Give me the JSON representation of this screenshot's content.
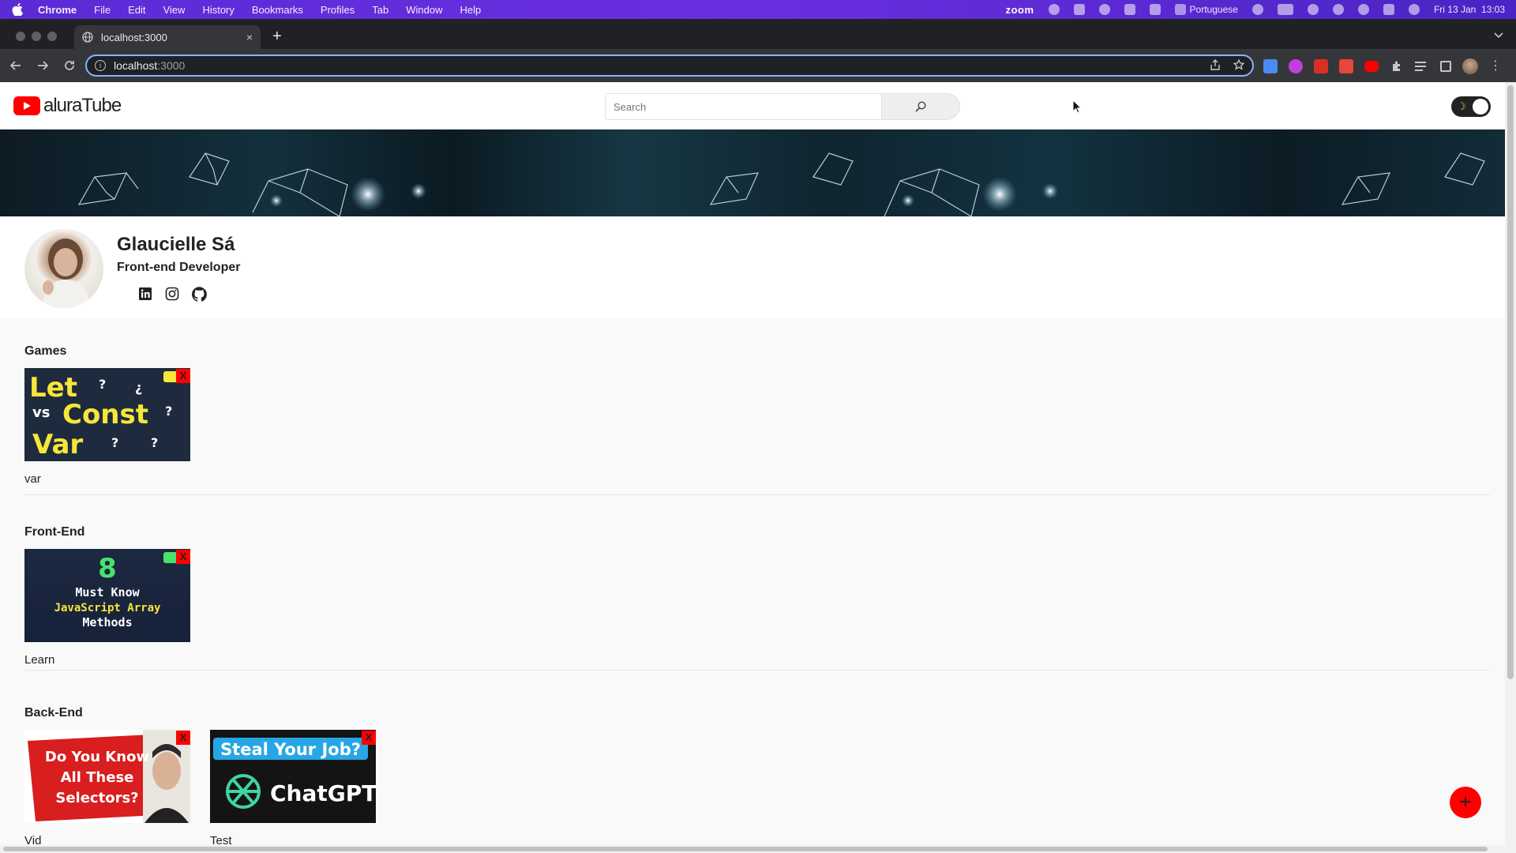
{
  "menubar": {
    "items": [
      "Chrome",
      "File",
      "Edit",
      "View",
      "History",
      "Bookmarks",
      "Profiles",
      "Tab",
      "Window",
      "Help"
    ],
    "zoom_label": "zoom",
    "input_language": "Portuguese",
    "datetime": "Fri 13 Jan  13:03"
  },
  "browser": {
    "tab_title": "localhost:3000",
    "tab_close": "×",
    "new_tab": "+",
    "url_host": "localhost",
    "url_port": ":3000"
  },
  "app": {
    "logo_text": "aluraTube",
    "search_placeholder": "Search",
    "theme_icon": "☽"
  },
  "profile": {
    "name": "Glaucielle Sá",
    "role": "Front-end Developer",
    "socials": [
      "linkedin-icon",
      "instagram-icon",
      "github-icon"
    ]
  },
  "playlists": [
    {
      "title": "Games",
      "videos": [
        {
          "title": "var",
          "thumb_text": [
            "Let",
            "vs",
            "Const",
            "Var"
          ]
        }
      ]
    },
    {
      "title": "Front-End",
      "videos": [
        {
          "title": "Learn",
          "thumb_text": [
            "8",
            "Must Know",
            "JavaScript Array",
            "Methods"
          ]
        }
      ]
    },
    {
      "title": "Back-End",
      "videos": [
        {
          "title": "Vid",
          "thumb_text": [
            "Do You Know",
            "All These",
            "Selectors?"
          ]
        },
        {
          "title": "Test",
          "thumb_text": [
            "Steal Your Job?",
            "ChatGPT"
          ]
        }
      ]
    }
  ],
  "remove_label": "X",
  "fab_label": "+",
  "colors": {
    "brand_red": "#ff0000",
    "menubar": "#5b2bd6",
    "page_bg": "#f9f9f9"
  }
}
